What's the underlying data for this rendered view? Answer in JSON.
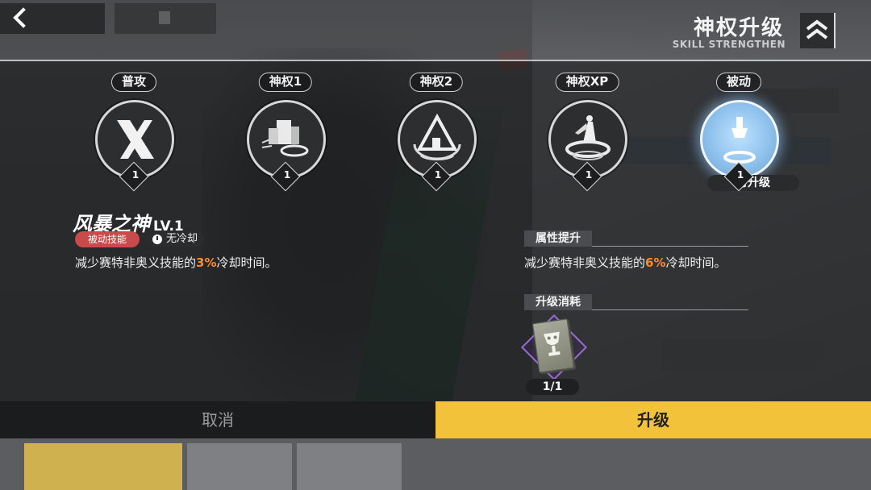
{
  "header": {
    "title": "神权升级",
    "subtitle": "SKILL STRENGTHEN",
    "back_icon": "chevron-left-icon",
    "rank_icon": "double-chevron-up-icon"
  },
  "skills": [
    {
      "label": "普攻",
      "level": "1",
      "icon": "x-slash-icon"
    },
    {
      "label": "神权1",
      "level": "1",
      "icon": "machine-icon"
    },
    {
      "label": "神权2",
      "level": "1",
      "icon": "pyramid-icon"
    },
    {
      "label": "神权XP",
      "level": "1",
      "icon": "figure-pedestal-icon"
    },
    {
      "label": "被动",
      "level": "1",
      "icon": "flask-icon",
      "status": "可升级"
    }
  ],
  "detail": {
    "name": "风暴之神",
    "level": "LV.1",
    "type_badge": "被动技能",
    "cooldown_badge": "无冷却",
    "desc_prefix": "减少赛特非奥义技能的",
    "desc_value": "3%",
    "desc_suffix": "冷却时间。"
  },
  "attribute": {
    "header": "属性提升",
    "desc_prefix": "减少赛特非奥义技能的",
    "desc_value": "6%",
    "desc_suffix": "冷却时间。"
  },
  "cost": {
    "header": "升级消耗",
    "item_icon": "chalice-book-icon",
    "count": "1/1"
  },
  "buttons": {
    "cancel": "取消",
    "upgrade": "升级"
  },
  "colors": {
    "accent_yellow": "#f2c23a",
    "highlight_orange": "#ff8a2a",
    "passive_red": "#c94a4a",
    "active_glow": "#8ec1ec"
  }
}
